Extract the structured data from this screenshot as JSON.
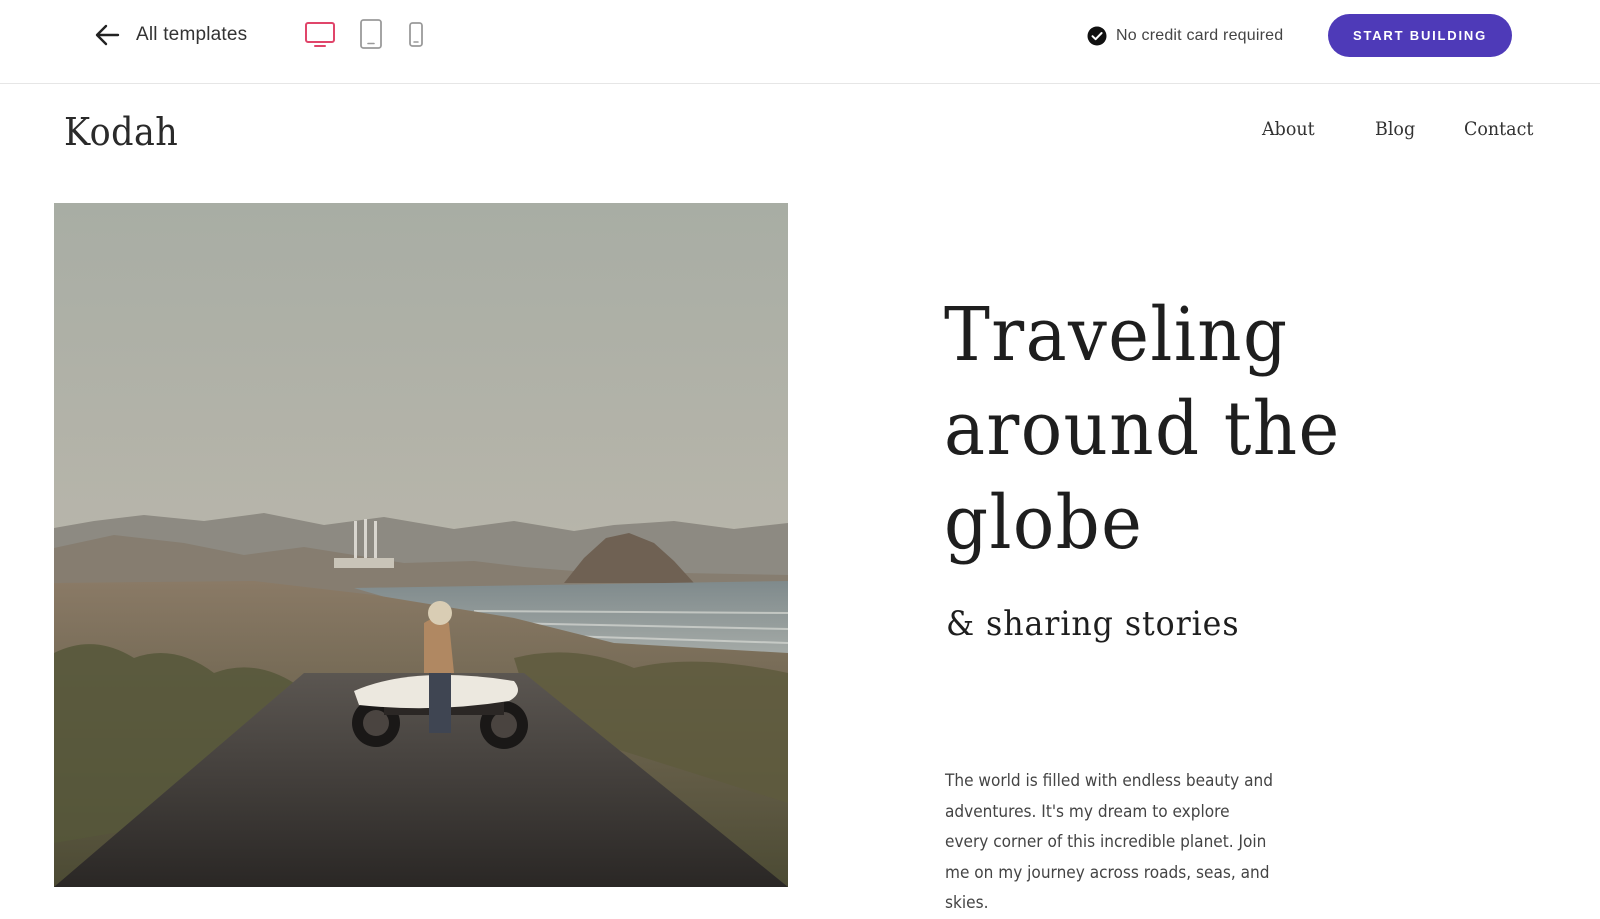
{
  "toolbar": {
    "back_label": "All templates",
    "devices": [
      {
        "name": "desktop",
        "active": true
      },
      {
        "name": "tablet",
        "active": false
      },
      {
        "name": "mobile",
        "active": false
      }
    ],
    "credit_note": "No credit card required",
    "cta_label": "START BUILDING",
    "accent_color": "#4e3ab8",
    "active_device_color": "#e0456a"
  },
  "site": {
    "logo": "Kodah",
    "nav": [
      "About",
      "Blog",
      "Contact"
    ],
    "hero": {
      "title": "Traveling around the globe",
      "subtitle": "& sharing stories",
      "body": "The world is filled with endless beauty and adventures. It's my dream to explore every corner of this incredible planet. Join me on my journey across roads, seas, and skies."
    }
  }
}
